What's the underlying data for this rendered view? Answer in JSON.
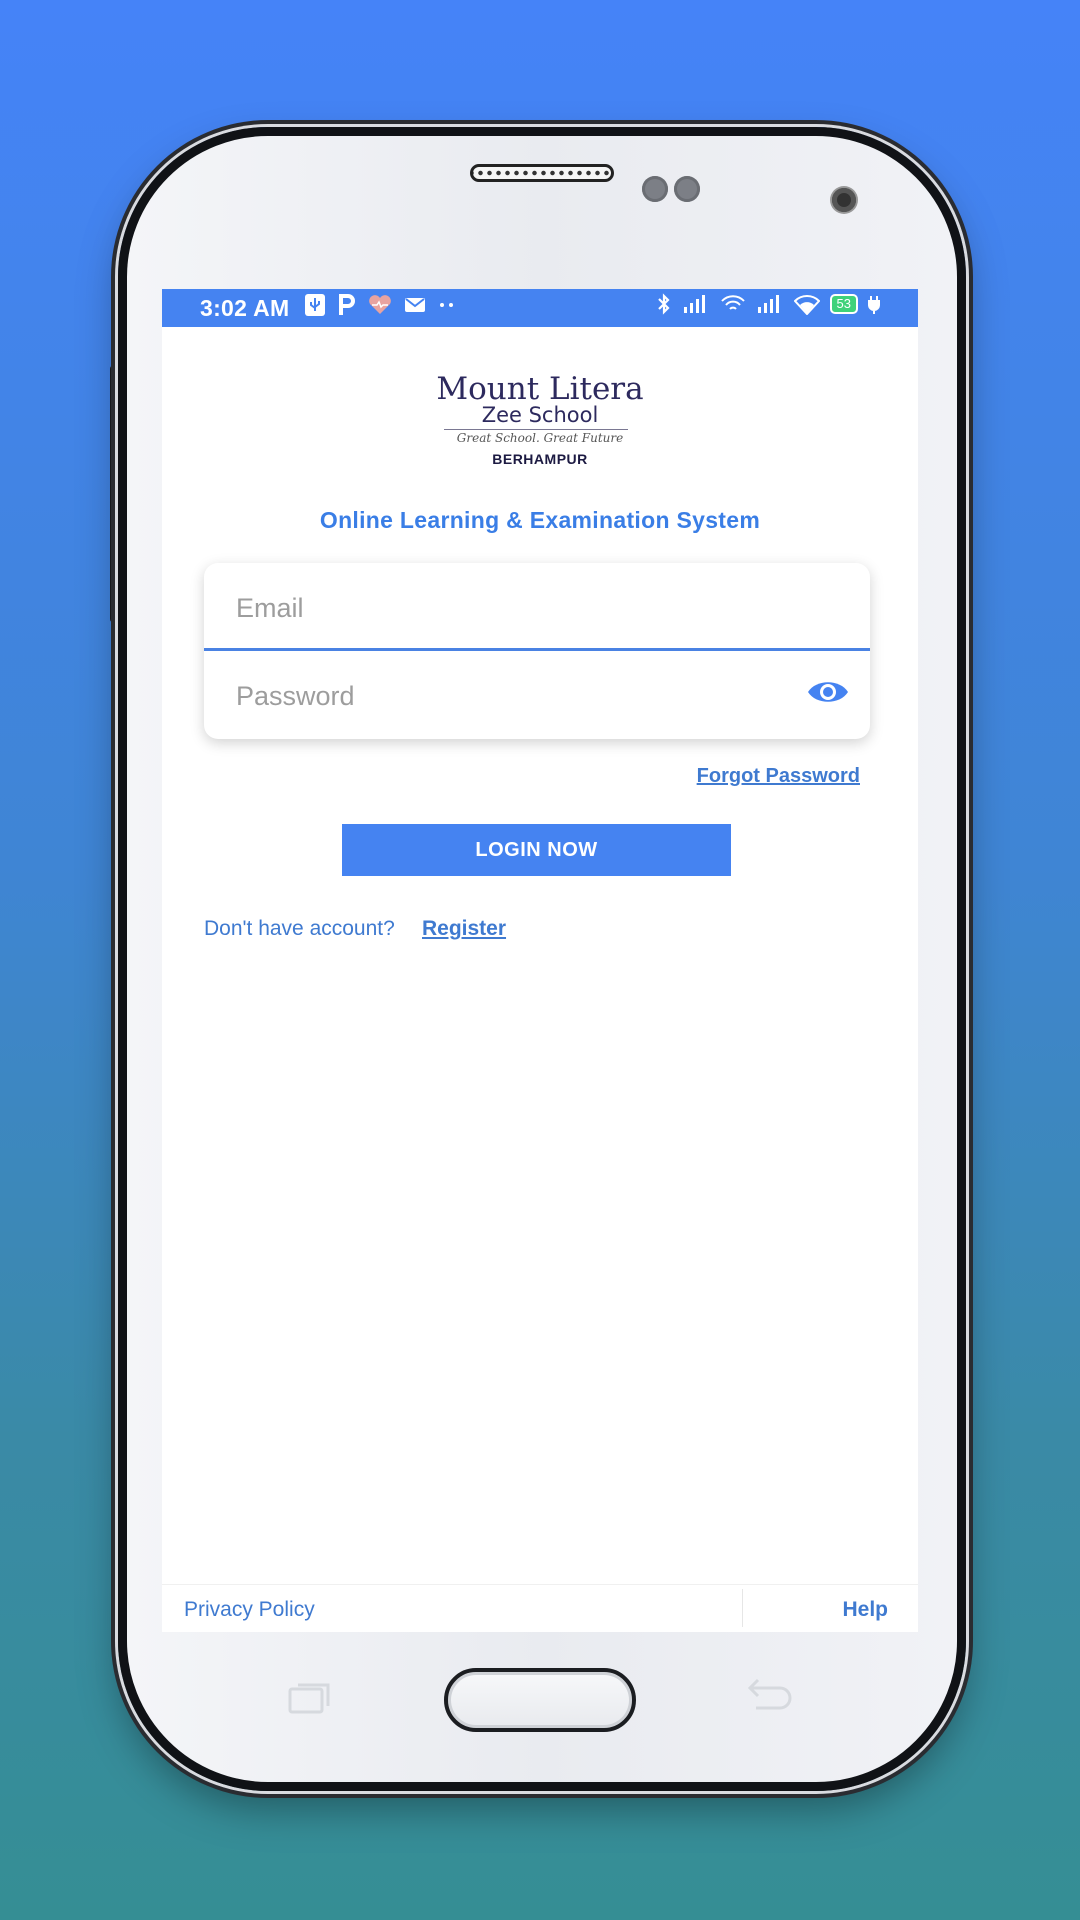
{
  "status_bar": {
    "time": "3:02 AM",
    "left_icons": [
      "usb-icon",
      "p-icon",
      "heart-icon",
      "mail-icon",
      "more-dots-icon"
    ],
    "right_icons": [
      "bluetooth-icon",
      "signal-icon",
      "wifi-calling-icon",
      "signal-icon",
      "wifi-icon",
      "battery-icon",
      "charging-icon"
    ],
    "battery_level": "53"
  },
  "logo": {
    "title": "Mount Litera",
    "subtitle": "Zee School",
    "tagline": "Great School. Great Future",
    "city": "BERHAMPUR"
  },
  "heading": "Online Learning & Examination System",
  "form": {
    "email_placeholder": "Email",
    "password_placeholder": "Password",
    "show_password_icon": "eye-icon"
  },
  "forgot_password": "Forgot Password",
  "login_button": "LOGIN NOW",
  "register_prompt": "Don't have account?",
  "register_link": "Register",
  "footer": {
    "privacy": "Privacy Policy",
    "help": "Help"
  },
  "colors": {
    "accent": "#4583f1",
    "link": "#3f7ad0",
    "heading": "#3a7ee6",
    "background_top": "#4583f8",
    "background_bottom": "#358e94"
  }
}
